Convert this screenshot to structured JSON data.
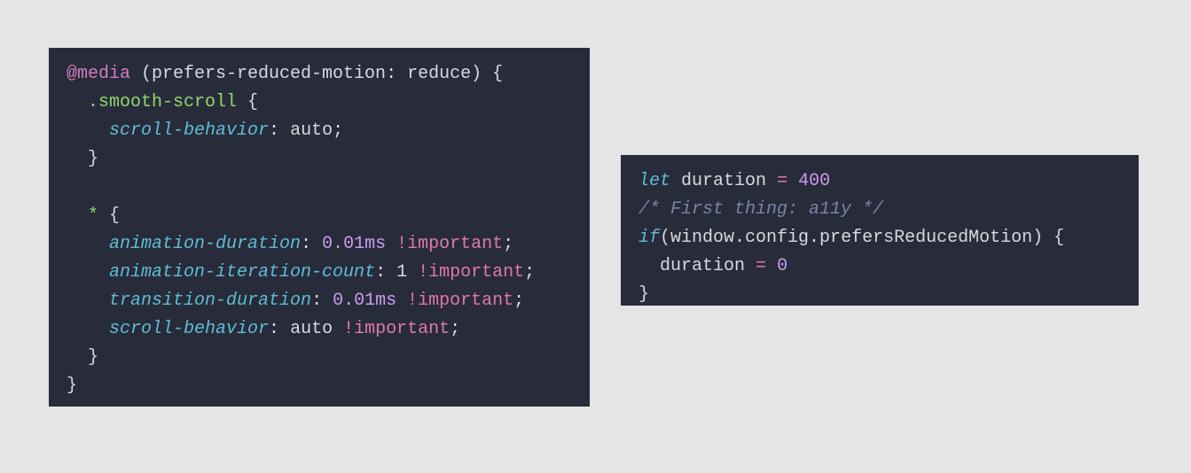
{
  "left": {
    "l1": {
      "media": "@media",
      "rest": " (prefers-reduced-motion: reduce) {"
    },
    "l2": {
      "indent": "  ",
      "sel": ".smooth-scroll",
      "rest": " {"
    },
    "l3": {
      "indent": "    ",
      "prop": "scroll-behavior",
      "colon": ": ",
      "val": "auto",
      "semi": ";"
    },
    "l4": {
      "indent": "  ",
      "brace": "}"
    },
    "l5": "",
    "l6": {
      "indent": "  ",
      "sel": "*",
      "rest": " {"
    },
    "l7": {
      "indent": "    ",
      "prop": "animation-duration",
      "colon": ": ",
      "num": "0.01ms",
      "sp": " ",
      "imp": "!important",
      "semi": ";"
    },
    "l8": {
      "indent": "    ",
      "prop": "animation-iteration-count",
      "colon": ": ",
      "val": "1",
      "sp": " ",
      "imp": "!important",
      "semi": ";"
    },
    "l9": {
      "indent": "    ",
      "prop": "transition-duration",
      "colon": ": ",
      "num": "0.01ms",
      "sp": " ",
      "imp": "!important",
      "semi": ";"
    },
    "l10": {
      "indent": "    ",
      "prop": "scroll-behavior",
      "colon": ": ",
      "val": "auto",
      "sp": " ",
      "imp": "!important",
      "semi": ";"
    },
    "l11": {
      "indent": "  ",
      "brace": "}"
    },
    "l12": {
      "brace": "}"
    }
  },
  "right": {
    "l1": {
      "kw": "let",
      "sp1": " ",
      "id": "duration",
      "sp2": " ",
      "op": "=",
      "sp3": " ",
      "num": "400"
    },
    "l2": {
      "comment": "/* First thing: a11y */"
    },
    "l3": {
      "kw": "if",
      "open": "(",
      "chain": "window.config.prefersReducedMotion",
      "close": ") {"
    },
    "l4": {
      "indent": "  ",
      "id": "duration",
      "sp1": " ",
      "op": "=",
      "sp2": " ",
      "num": "0"
    },
    "l5": {
      "brace": "}"
    }
  }
}
